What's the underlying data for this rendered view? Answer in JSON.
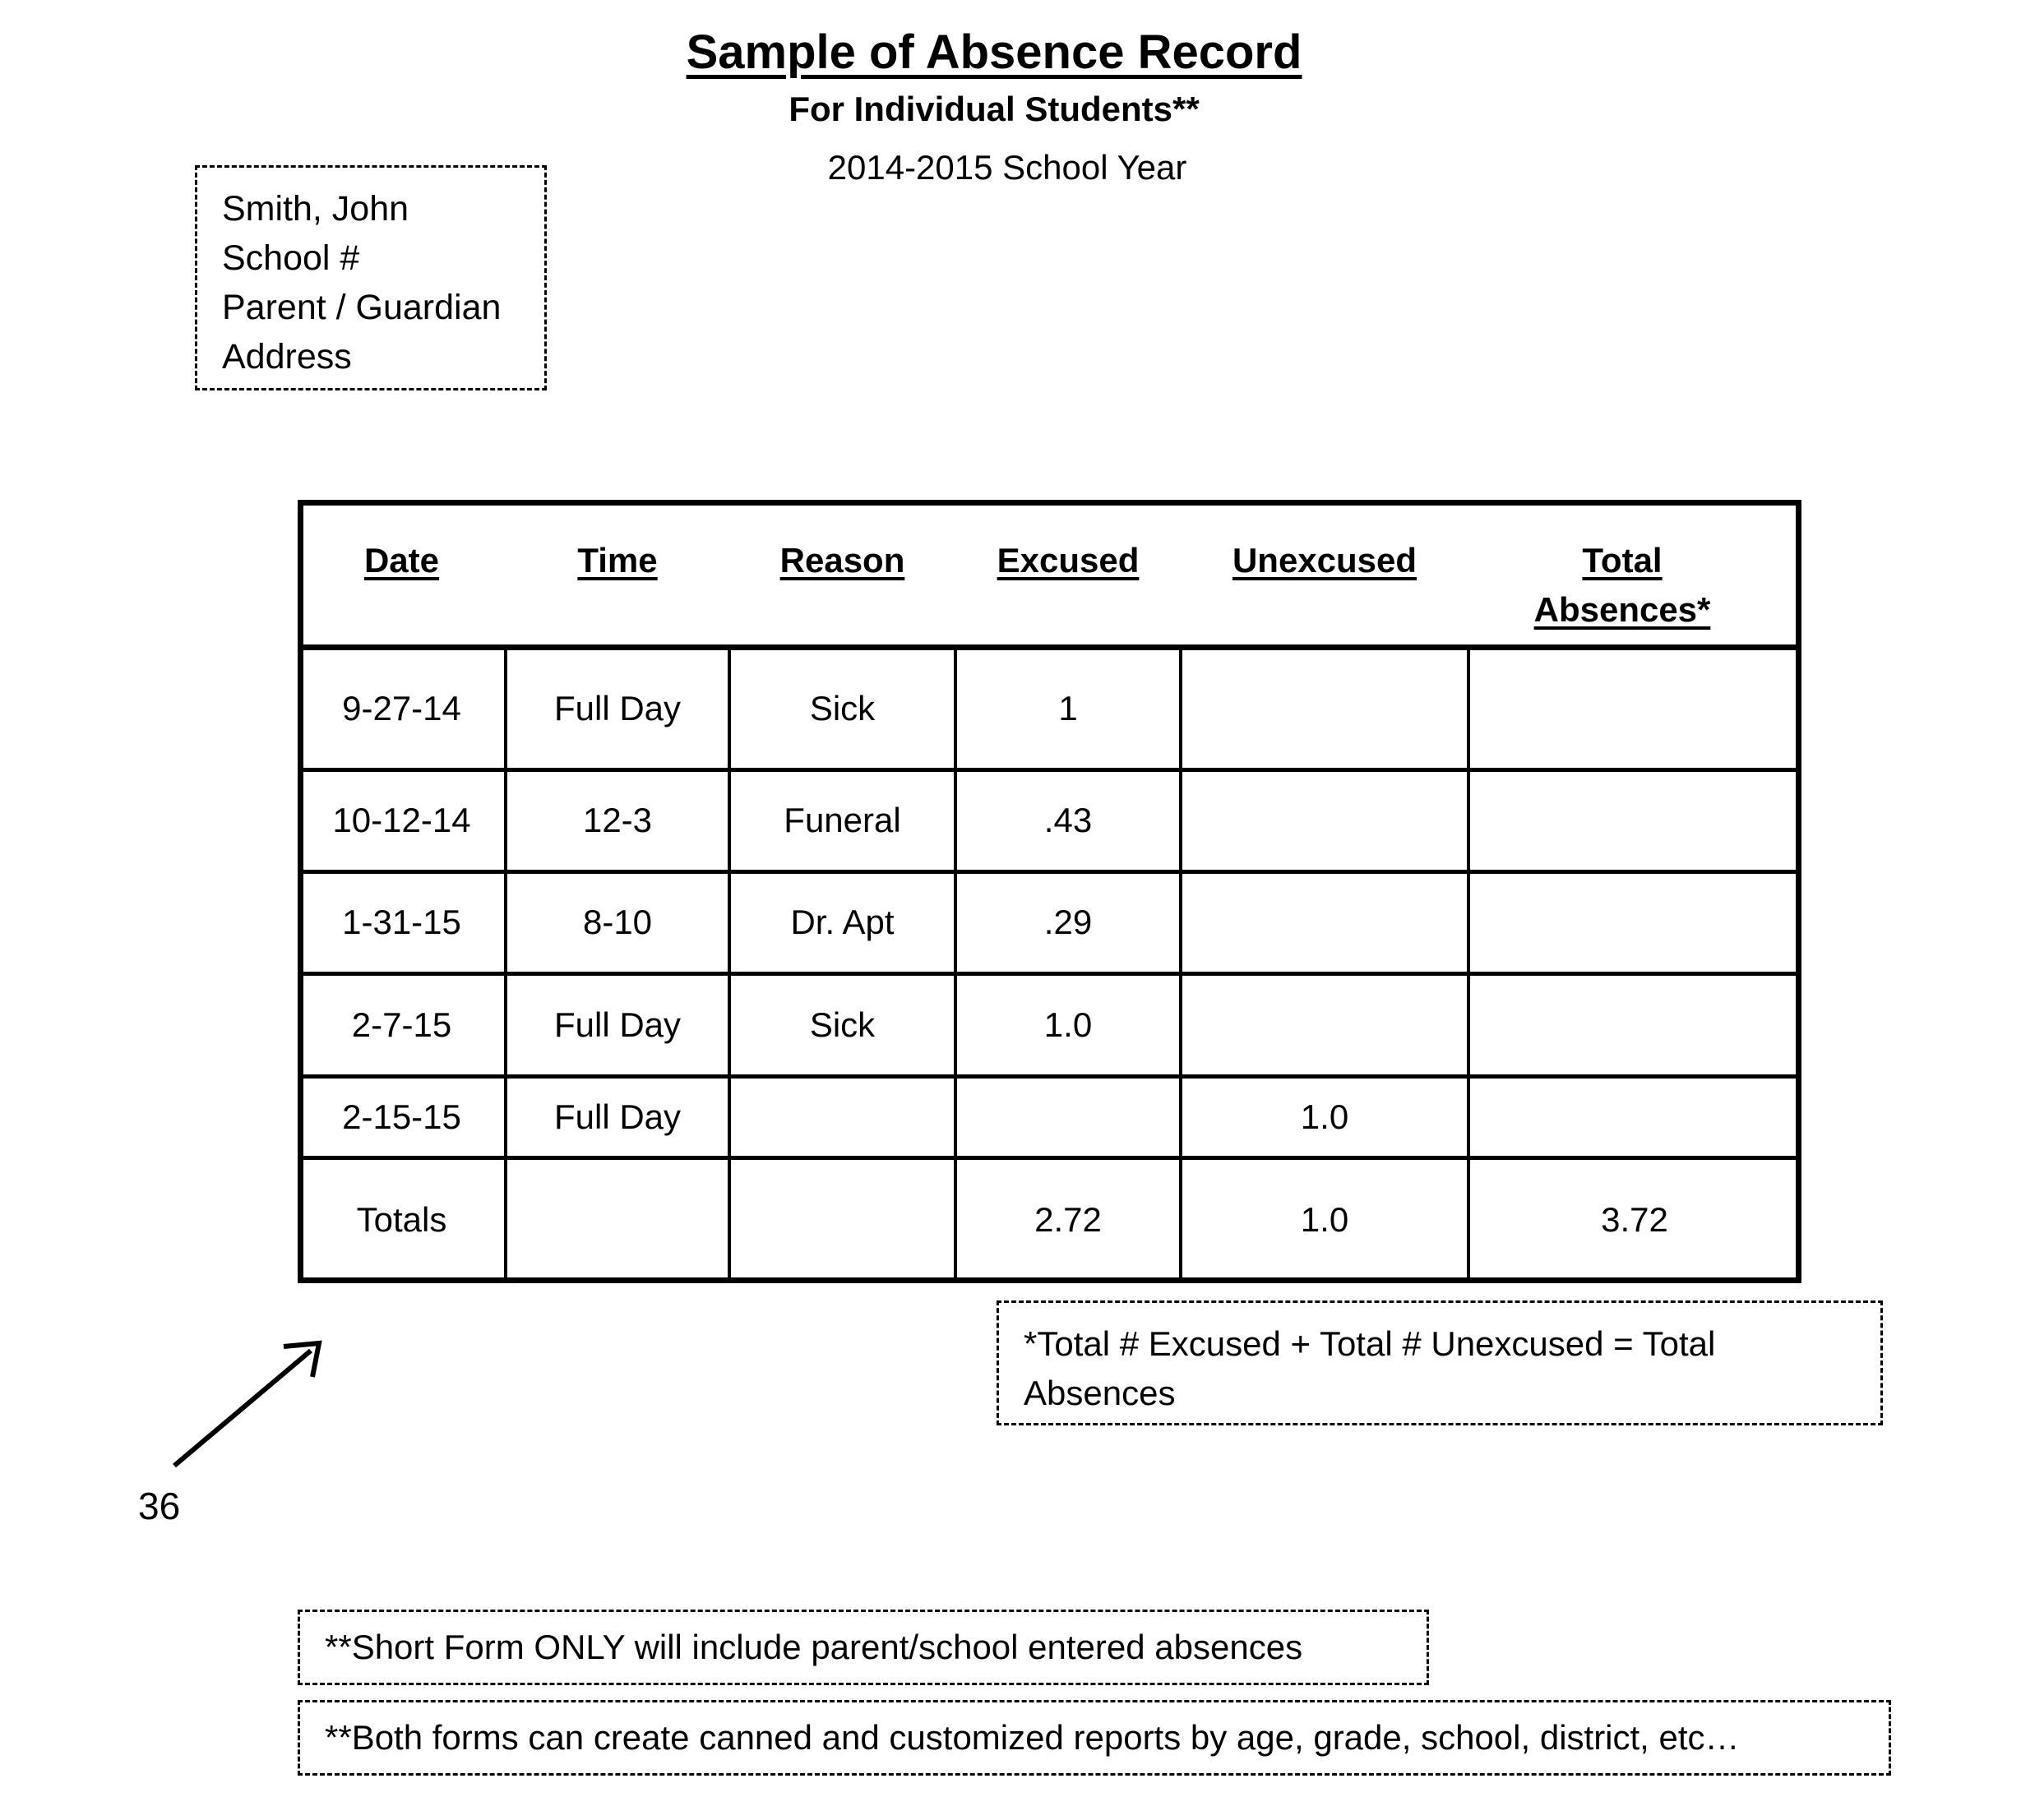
{
  "header": {
    "title": "Sample of Absence Record",
    "subtitle": "For Individual Students**",
    "school_year": "2014-2015 School Year"
  },
  "student_info": {
    "lines": [
      "Smith, John",
      "School #",
      "Parent / Guardian",
      "Address"
    ]
  },
  "table": {
    "columns": [
      "Date",
      "Time",
      "Reason",
      "Excused",
      "Unexcused",
      "Total Absences*"
    ],
    "column_header_lines": {
      "total_line1": "Total",
      "total_line2": "Absences*"
    },
    "rows": [
      [
        "9-27-14",
        "Full Day",
        "Sick",
        "1",
        "",
        ""
      ],
      [
        "10-12-14",
        "12-3",
        "Funeral",
        ".43",
        "",
        ""
      ],
      [
        "1-31-15",
        "8-10",
        "Dr. Apt",
        ".29",
        "",
        ""
      ],
      [
        "2-7-15",
        "Full Day",
        "Sick",
        "1.0",
        "",
        ""
      ],
      [
        "2-15-15",
        "Full Day",
        "",
        "",
        "1.0",
        ""
      ],
      [
        "Totals",
        "",
        "",
        "2.72",
        "1.0",
        "3.72"
      ]
    ]
  },
  "notes": {
    "total_formula": "*Total # Excused  + Total # Unexcused = Total Absences",
    "short_form": "**Short Form ONLY will include parent/school entered absences",
    "both_forms": "**Both forms can create canned and customized reports by age, grade, school, district, etc…"
  },
  "reference": {
    "label": "36",
    "arrow_icon": "arrow-up-right-icon"
  }
}
